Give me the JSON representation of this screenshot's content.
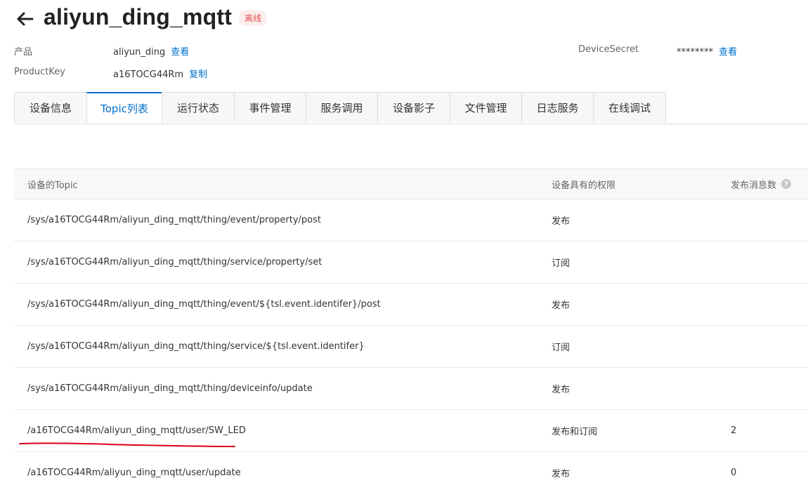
{
  "header": {
    "title": "aliyun_ding_mqtt",
    "status_badge": "离线"
  },
  "info": {
    "product_label": "产品",
    "product_value": "aliyun_ding",
    "product_link": "查看",
    "productkey_label": "ProductKey",
    "productkey_value": "a16TOCG44Rm",
    "productkey_link": "复制",
    "secret_label": "DeviceSecret",
    "secret_value": "********",
    "secret_link": "查看"
  },
  "tabs": [
    {
      "label": "设备信息"
    },
    {
      "label": "Topic列表",
      "active": true
    },
    {
      "label": "运行状态"
    },
    {
      "label": "事件管理"
    },
    {
      "label": "服务调用"
    },
    {
      "label": "设备影子"
    },
    {
      "label": "文件管理"
    },
    {
      "label": "日志服务"
    },
    {
      "label": "在线调试"
    }
  ],
  "table": {
    "headers": [
      "设备的Topic",
      "设备具有的权限",
      "发布消息数"
    ],
    "rows": [
      {
        "topic": "/sys/a16TOCG44Rm/aliyun_ding_mqtt/thing/event/property/post",
        "permission": "发布",
        "count": ""
      },
      {
        "topic": "/sys/a16TOCG44Rm/aliyun_ding_mqtt/thing/service/property/set",
        "permission": "订阅",
        "count": ""
      },
      {
        "topic": "/sys/a16TOCG44Rm/aliyun_ding_mqtt/thing/event/${tsl.event.identifer}/post",
        "permission": "发布",
        "count": ""
      },
      {
        "topic": "/sys/a16TOCG44Rm/aliyun_ding_mqtt/thing/service/${tsl.event.identifer}",
        "permission": "订阅",
        "count": ""
      },
      {
        "topic": "/sys/a16TOCG44Rm/aliyun_ding_mqtt/thing/deviceinfo/update",
        "permission": "发布",
        "count": ""
      },
      {
        "topic": "/a16TOCG44Rm/aliyun_ding_mqtt/user/SW_LED",
        "permission": "发布和订阅",
        "count": "2"
      },
      {
        "topic": "/a16TOCG44Rm/aliyun_ding_mqtt/user/update",
        "permission": "发布",
        "count": "0"
      }
    ]
  },
  "colors": {
    "accent": "#0070cc",
    "badge_text": "#e0504f",
    "annotation": "#d9001b"
  }
}
